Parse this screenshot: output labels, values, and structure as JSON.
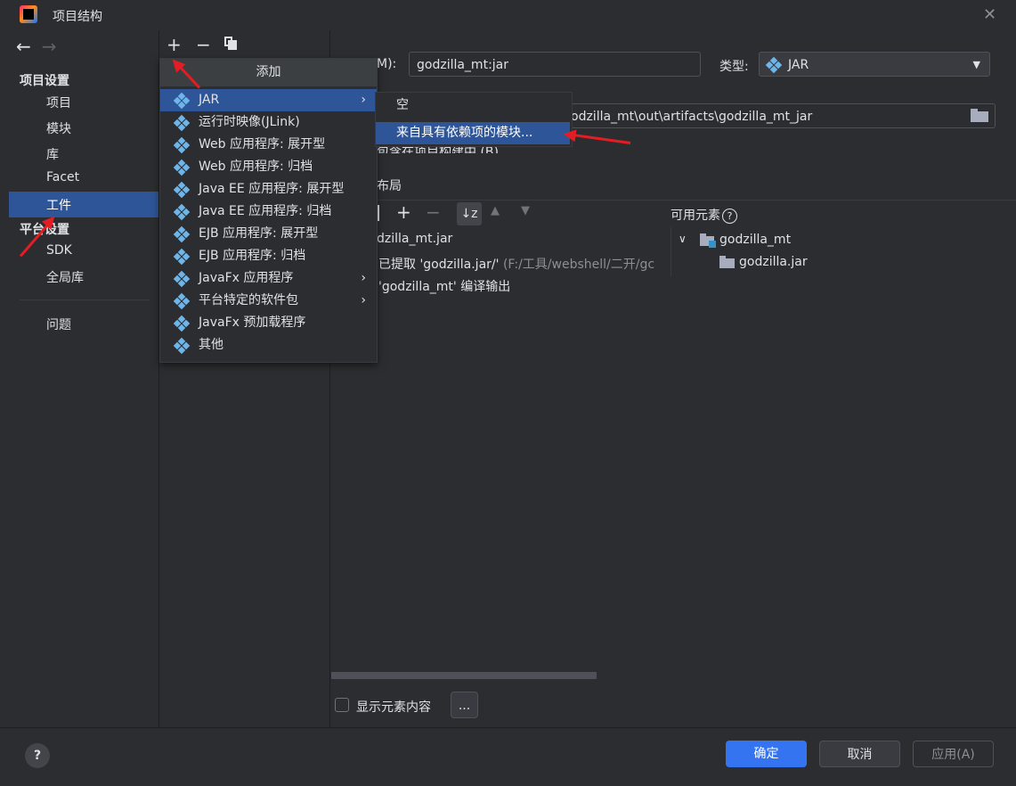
{
  "window": {
    "title": "项目结构"
  },
  "sidebar": {
    "section_project": "项目设置",
    "items_project": [
      "项目",
      "模块",
      "库",
      "Facet",
      "工件"
    ],
    "section_platform": "平台设置",
    "items_platform": [
      "SDK",
      "全局库"
    ],
    "item_problems": "问题"
  },
  "add_popup": {
    "header": "添加",
    "items": [
      {
        "label": "JAR",
        "icon": "jar-diamond-icon",
        "has_submenu": true
      },
      {
        "label": "运行时映像(JLink)",
        "icon": "diamond-icon"
      },
      {
        "label": "Web 应用程序: 展开型",
        "icon": "web-app-icon"
      },
      {
        "label": "Web 应用程序: 归档",
        "icon": "web-app-icon"
      },
      {
        "label": "Java EE 应用程序: 展开型",
        "icon": "javaee-app-icon"
      },
      {
        "label": "Java EE 应用程序: 归档",
        "icon": "javaee-app-icon"
      },
      {
        "label": "EJB 应用程序: 展开型",
        "icon": "ejb-app-icon"
      },
      {
        "label": "EJB 应用程序: 归档",
        "icon": "ejb-app-icon"
      },
      {
        "label": "JavaFx 应用程序",
        "icon": "diamond-icon",
        "has_submenu": true
      },
      {
        "label": "平台特定的软件包",
        "icon": "diamond-icon",
        "has_submenu": true
      },
      {
        "label": "JavaFx 预加载程序",
        "icon": "diamond-icon"
      },
      {
        "label": "其他",
        "icon": "diamond-icon"
      }
    ]
  },
  "jar_submenu": {
    "items": [
      "空",
      "来自具有依赖项的模块..."
    ]
  },
  "details": {
    "name_label_fragment": "M):",
    "name_value": "godzilla_mt:jar",
    "type_label": "类型:",
    "type_value": "JAR",
    "output_path": "odzilla_mt\\out\\artifacts\\godzilla_mt_jar",
    "include_build_fragment": "包含在项目构建中 (B)",
    "layout_fragment": "布局",
    "available_elements_label": "可用元素",
    "output_tree": [
      "dzilla_mt.jar",
      "已提取 'godzilla.jar/'",
      "'godzilla_mt' 编译输出"
    ],
    "extracted_path_gray": "(F:/工具/webshell/二开/gc",
    "available_tree": {
      "root": "godzilla_mt",
      "child": "godzilla.jar"
    },
    "show_contents_label": "显示元素内容",
    "ellipsis_button": "..."
  },
  "footer": {
    "ok": "确定",
    "cancel": "取消",
    "apply": "应用(A)"
  },
  "colors": {
    "background": "#2b2d30",
    "selection": "#2e5597",
    "primary_button": "#3574f0",
    "annotation_arrow": "#e51c23"
  }
}
